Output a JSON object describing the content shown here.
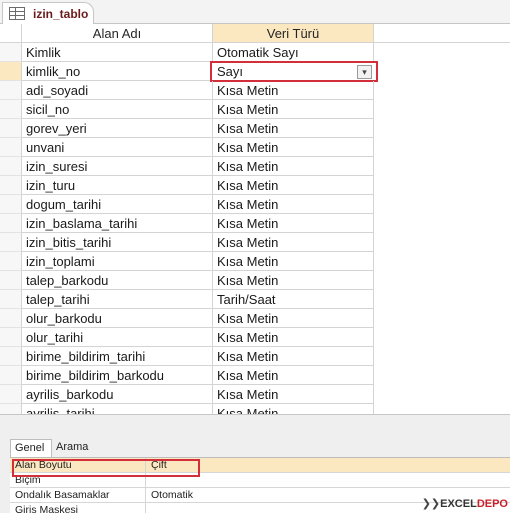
{
  "object_tab": {
    "label": "izin_tablo",
    "icon": "table-icon"
  },
  "grid": {
    "headers": [
      "Alan Adı",
      "Veri Türü"
    ],
    "rows": [
      {
        "name": "Kimlik",
        "type": "Otomatik Sayı"
      },
      {
        "name": "kimlik_no",
        "type": "Sayı"
      },
      {
        "name": "adi_soyadi",
        "type": "Kısa Metin"
      },
      {
        "name": "sicil_no",
        "type": "Kısa Metin"
      },
      {
        "name": "gorev_yeri",
        "type": "Kısa Metin"
      },
      {
        "name": "unvani",
        "type": "Kısa Metin"
      },
      {
        "name": "izin_suresi",
        "type": "Kısa Metin"
      },
      {
        "name": "izin_turu",
        "type": "Kısa Metin"
      },
      {
        "name": "dogum_tarihi",
        "type": "Kısa Metin"
      },
      {
        "name": "izin_baslama_tarihi",
        "type": "Kısa Metin"
      },
      {
        "name": "izin_bitis_tarihi",
        "type": "Kısa Metin"
      },
      {
        "name": "izin_toplami",
        "type": "Kısa Metin"
      },
      {
        "name": "talep_barkodu",
        "type": "Kısa Metin"
      },
      {
        "name": "talep_tarihi",
        "type": "Tarih/Saat"
      },
      {
        "name": "olur_barkodu",
        "type": "Kısa Metin"
      },
      {
        "name": "olur_tarihi",
        "type": "Kısa Metin"
      },
      {
        "name": "birime_bildirim_tarihi",
        "type": "Kısa Metin"
      },
      {
        "name": "birime_bildirim_barkodu",
        "type": "Kısa Metin"
      },
      {
        "name": "ayrilis_barkodu",
        "type": "Kısa Metin"
      },
      {
        "name": "ayrilis_tarihi",
        "type": "Kısa Metin"
      }
    ],
    "active_row": 1,
    "combo_icon": "chevron-down-icon"
  },
  "properties": {
    "tabs": [
      "Genel",
      "Arama"
    ],
    "rows": [
      {
        "key": "Alan Boyutu",
        "value": "Çift"
      },
      {
        "key": "Biçim",
        "value": ""
      },
      {
        "key": "Ondalık Basamaklar",
        "value": "Otomatik"
      },
      {
        "key": "Giriş Maskesi",
        "value": ""
      }
    ]
  },
  "watermark": {
    "prefix": "❯❯",
    "brand": "EXCEL",
    "brand2": "DEPO"
  },
  "colors": {
    "highlight_red": "#d32f3a",
    "selected_row": "#fbe7c0"
  }
}
